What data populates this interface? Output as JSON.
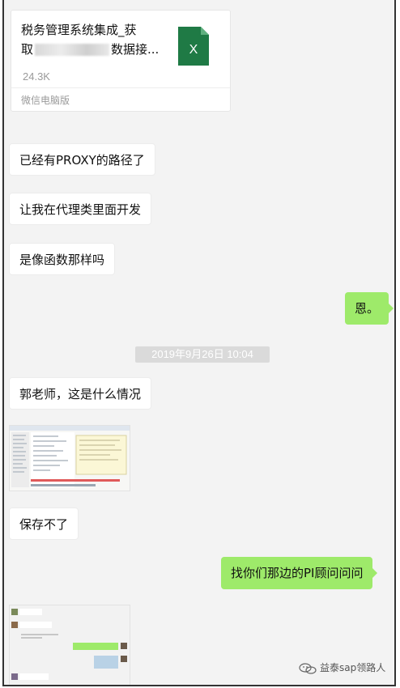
{
  "file_card": {
    "title_line1": "税务管理系统集成_获",
    "title_line2_start": "取",
    "title_line2_end": "数据接...",
    "size": "24.3K",
    "source": "微信电脑版",
    "file_type_icon": "excel-file-icon",
    "file_type_letter": "X"
  },
  "messages": [
    {
      "side": "left",
      "text": "已经有PROXY的路径了"
    },
    {
      "side": "left",
      "text": "让我在代理类里面开发"
    },
    {
      "side": "left",
      "text": "是像函数那样吗"
    },
    {
      "side": "right",
      "text": "恩。"
    },
    {
      "side": "left",
      "text": "郭老师，这是什么情况"
    },
    {
      "side": "left",
      "text": "保存不了"
    },
    {
      "side": "right",
      "text": "找你们那边的PI顾问问问"
    }
  ],
  "timestamp": "2019年9月26日 10:04",
  "watermark": "益泰sap领路人",
  "colors": {
    "chat_bg": "#f3f3f3",
    "right_bubble": "#9eea6a",
    "excel_green": "#1f7a45"
  }
}
